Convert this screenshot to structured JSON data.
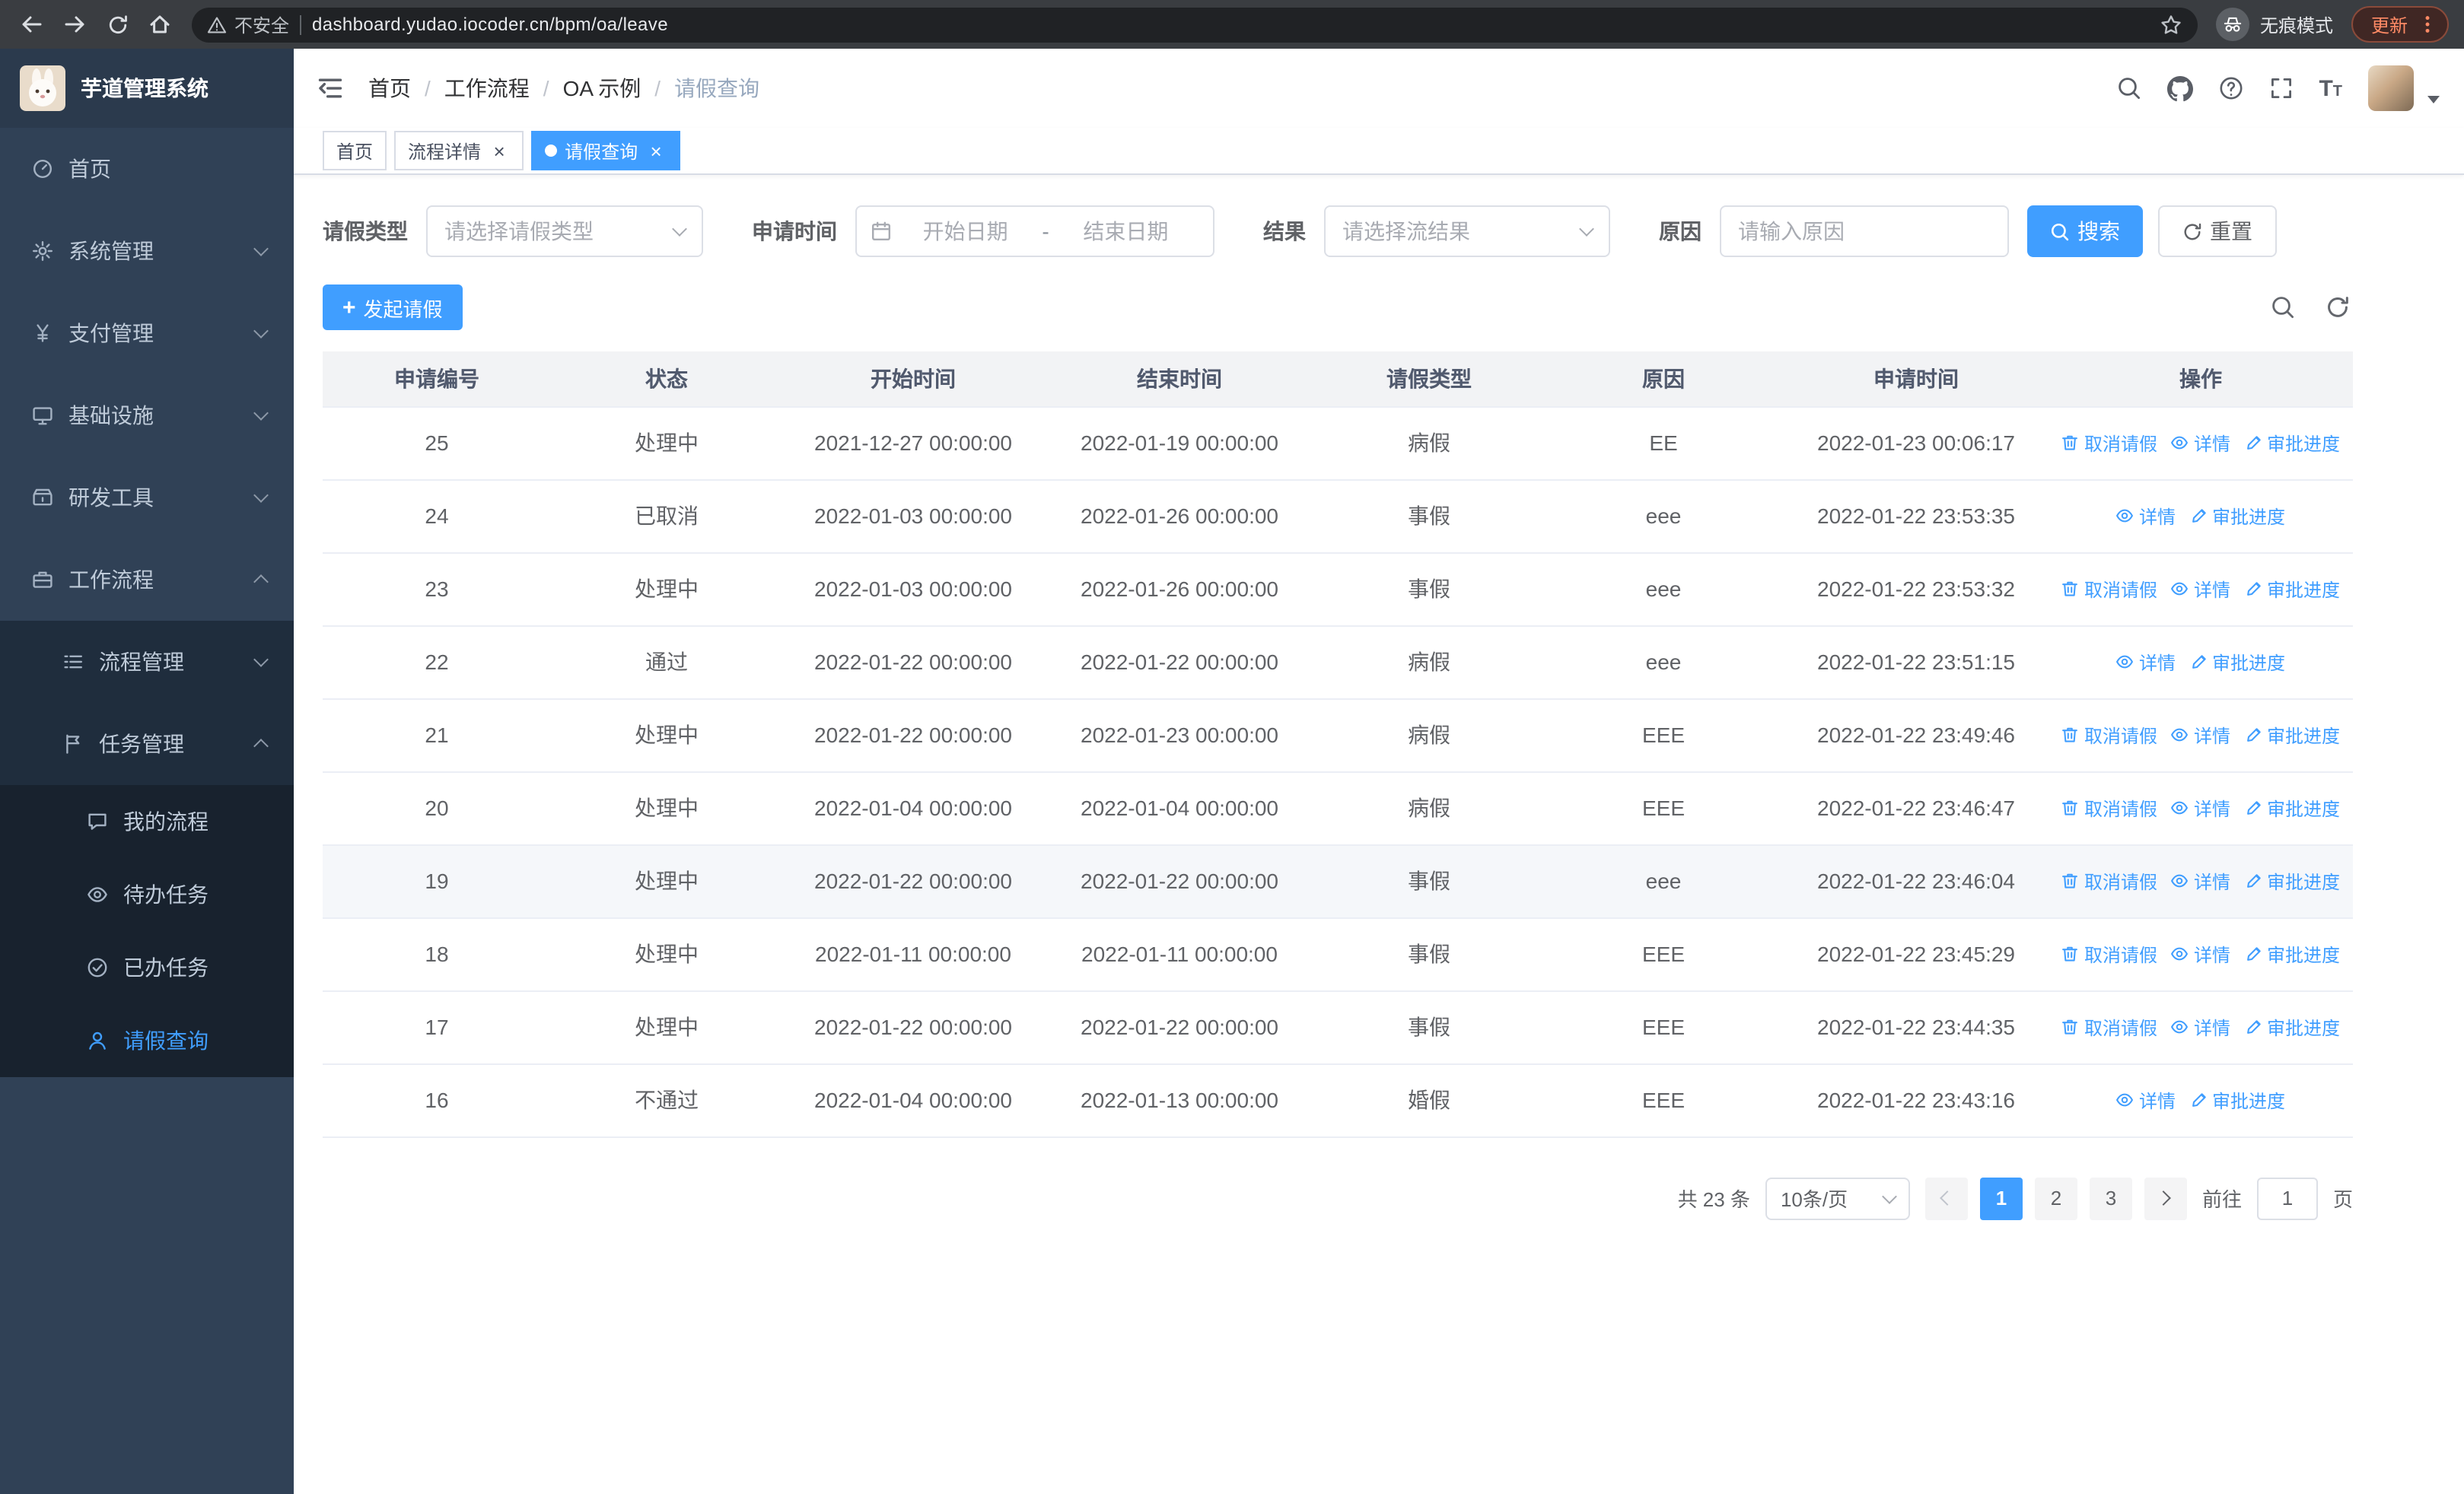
{
  "browser": {
    "security_chip": "不安全",
    "url": "dashboard.yudao.iocoder.cn/bpm/oa/leave",
    "incognito_label": "无痕模式",
    "update_label": "更新"
  },
  "sidebar": {
    "app_title": "芋道管理系统",
    "menu": [
      {
        "label": "首页",
        "icon": "dashboard-icon",
        "level": 1
      },
      {
        "label": "系统管理",
        "icon": "gear-icon",
        "level": 1,
        "chevron": "down"
      },
      {
        "label": "支付管理",
        "icon": "yen-icon",
        "level": 1,
        "chevron": "down"
      },
      {
        "label": "基础设施",
        "icon": "monitor-icon",
        "level": 1,
        "chevron": "down"
      },
      {
        "label": "研发工具",
        "icon": "tool-icon",
        "level": 1,
        "chevron": "down"
      },
      {
        "label": "工作流程",
        "icon": "briefcase-icon",
        "level": 1,
        "chevron": "up"
      },
      {
        "label": "流程管理",
        "icon": "list-icon",
        "level": 2,
        "chevron": "down"
      },
      {
        "label": "任务管理",
        "icon": "flag-icon",
        "level": 2,
        "chevron": "up"
      },
      {
        "label": "我的流程",
        "icon": "chat-icon",
        "level": 3
      },
      {
        "label": "待办任务",
        "icon": "eye-icon",
        "level": 3
      },
      {
        "label": "已办任务",
        "icon": "check-circle-icon",
        "level": 3
      },
      {
        "label": "请假查询",
        "icon": "user-icon",
        "level": 3,
        "active": true
      }
    ]
  },
  "header": {
    "breadcrumb": [
      "首页",
      "工作流程",
      "OA 示例",
      "请假查询"
    ]
  },
  "tabs": [
    {
      "label": "首页",
      "closable": false,
      "active": false
    },
    {
      "label": "流程详情",
      "closable": true,
      "active": false
    },
    {
      "label": "请假查询",
      "closable": true,
      "active": true
    }
  ],
  "filters": {
    "leave_type_label": "请假类型",
    "leave_type_placeholder": "请选择请假类型",
    "apply_time_label": "申请时间",
    "start_date_placeholder": "开始日期",
    "range_separator": "-",
    "end_date_placeholder": "结束日期",
    "result_label": "结果",
    "result_placeholder": "请选择流结果",
    "reason_label": "原因",
    "reason_placeholder": "请输入原因",
    "search_button": "搜索",
    "reset_button": "重置"
  },
  "toolbar": {
    "create_button": "发起请假"
  },
  "table": {
    "columns": [
      "申请编号",
      "状态",
      "开始时间",
      "结束时间",
      "请假类型",
      "原因",
      "申请时间",
      "操作"
    ],
    "action_labels": {
      "cancel": "取消请假",
      "detail": "详情",
      "progress": "审批进度"
    },
    "highlighted_row": "19",
    "rows": [
      {
        "id": "25",
        "status": "处理中",
        "start": "2021-12-27 00:00:00",
        "end": "2022-01-19 00:00:00",
        "type": "病假",
        "reason": "EE",
        "applied": "2022-01-23 00:06:17",
        "actions": [
          "cancel",
          "detail",
          "progress"
        ]
      },
      {
        "id": "24",
        "status": "已取消",
        "start": "2022-01-03 00:00:00",
        "end": "2022-01-26 00:00:00",
        "type": "事假",
        "reason": "eee",
        "applied": "2022-01-22 23:53:35",
        "actions": [
          "detail",
          "progress"
        ]
      },
      {
        "id": "23",
        "status": "处理中",
        "start": "2022-01-03 00:00:00",
        "end": "2022-01-26 00:00:00",
        "type": "事假",
        "reason": "eee",
        "applied": "2022-01-22 23:53:32",
        "actions": [
          "cancel",
          "detail",
          "progress"
        ]
      },
      {
        "id": "22",
        "status": "通过",
        "start": "2022-01-22 00:00:00",
        "end": "2022-01-22 00:00:00",
        "type": "病假",
        "reason": "eee",
        "applied": "2022-01-22 23:51:15",
        "actions": [
          "detail",
          "progress"
        ]
      },
      {
        "id": "21",
        "status": "处理中",
        "start": "2022-01-22 00:00:00",
        "end": "2022-01-23 00:00:00",
        "type": "病假",
        "reason": "EEE",
        "applied": "2022-01-22 23:49:46",
        "actions": [
          "cancel",
          "detail",
          "progress"
        ]
      },
      {
        "id": "20",
        "status": "处理中",
        "start": "2022-01-04 00:00:00",
        "end": "2022-01-04 00:00:00",
        "type": "病假",
        "reason": "EEE",
        "applied": "2022-01-22 23:46:47",
        "actions": [
          "cancel",
          "detail",
          "progress"
        ]
      },
      {
        "id": "19",
        "status": "处理中",
        "start": "2022-01-22 00:00:00",
        "end": "2022-01-22 00:00:00",
        "type": "事假",
        "reason": "eee",
        "applied": "2022-01-22 23:46:04",
        "actions": [
          "cancel",
          "detail",
          "progress"
        ]
      },
      {
        "id": "18",
        "status": "处理中",
        "start": "2022-01-11 00:00:00",
        "end": "2022-01-11 00:00:00",
        "type": "事假",
        "reason": "EEE",
        "applied": "2022-01-22 23:45:29",
        "actions": [
          "cancel",
          "detail",
          "progress"
        ]
      },
      {
        "id": "17",
        "status": "处理中",
        "start": "2022-01-22 00:00:00",
        "end": "2022-01-22 00:00:00",
        "type": "事假",
        "reason": "EEE",
        "applied": "2022-01-22 23:44:35",
        "actions": [
          "cancel",
          "detail",
          "progress"
        ]
      },
      {
        "id": "16",
        "status": "不通过",
        "start": "2022-01-04 00:00:00",
        "end": "2022-01-13 00:00:00",
        "type": "婚假",
        "reason": "EEE",
        "applied": "2022-01-22 23:43:16",
        "actions": [
          "detail",
          "progress"
        ]
      }
    ]
  },
  "pagination": {
    "total_text": "共 23 条",
    "page_size": "10条/页",
    "pages": [
      "1",
      "2",
      "3"
    ],
    "active_page": "1",
    "goto_label": "前往",
    "goto_value": "1",
    "page_suffix": "页"
  },
  "icons": {
    "plus": "+",
    "close": "×",
    "fontsize_large": "T",
    "fontsize_small": "T"
  }
}
